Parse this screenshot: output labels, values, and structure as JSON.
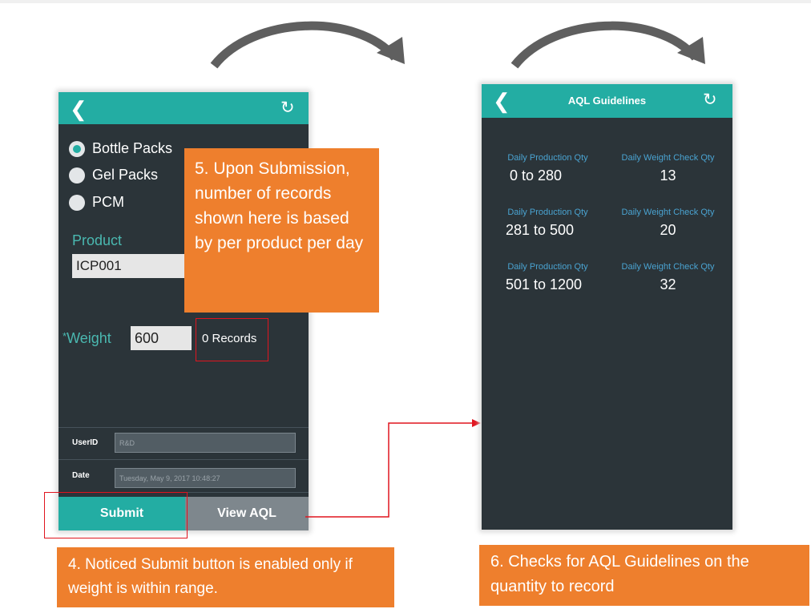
{
  "form_screen": {
    "radio_options": [
      {
        "label": "Bottle Packs",
        "selected": true
      },
      {
        "label": "Gel Packs",
        "selected": false
      },
      {
        "label": "PCM",
        "selected": false
      }
    ],
    "product_label": "Product",
    "product_value": "ICP001",
    "weight_label": "Weight",
    "weight_required_mark": "*",
    "weight_value": "600",
    "records_text": "0 Records",
    "userid_label": "UserID",
    "userid_value": "R&D",
    "date_label": "Date",
    "date_value": "Tuesday, May 9, 2017 10:48:27",
    "submit_label": "Submit",
    "view_aql_label": "View AQL"
  },
  "aql_screen": {
    "title": "AQL Guidelines",
    "column_headers": [
      "Daily Production Qty",
      "Daily Weight Check Qty"
    ],
    "rows": [
      {
        "production_qty": "0 to 280",
        "weight_check_qty": "13"
      },
      {
        "production_qty": "281 to 500",
        "weight_check_qty": "20"
      },
      {
        "production_qty": "501 to 1200",
        "weight_check_qty": "32"
      }
    ]
  },
  "callouts": {
    "step5": "5. Upon Submission, number of records shown here is based by per product per day",
    "step4": "4. Noticed Submit button is enabled only if weight is within range.",
    "step6": "6. Checks for AQL Guidelines on the quantity to record"
  },
  "colors": {
    "teal": "#23ada3",
    "panel": "#2b3439",
    "callout_orange": "#ee7f2d",
    "highlight_red": "#e0151f",
    "aql_header_blue": "#4aa3d1"
  }
}
